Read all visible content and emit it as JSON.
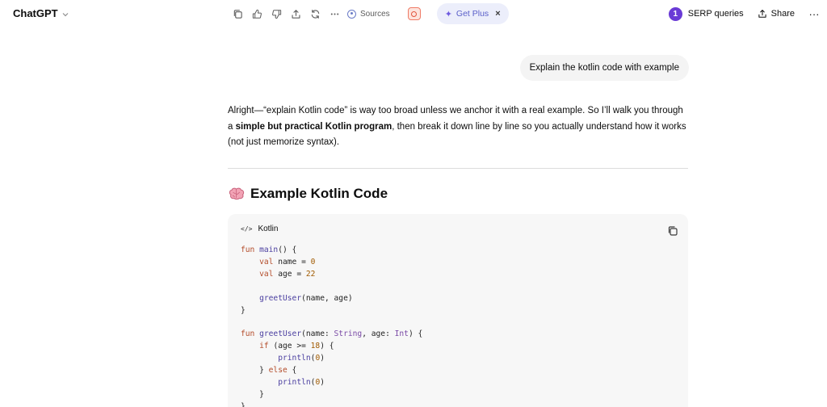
{
  "app": {
    "title": "ChatGPT"
  },
  "toolbar": {
    "sources_label": "Sources",
    "get_plus_label": "Get Plus",
    "get_plus_close": "×",
    "icons": [
      "copy-icon",
      "thumbs-up-icon",
      "thumbs-down-icon",
      "share-up-icon",
      "regenerate-icon",
      "more-icon",
      "sources-icon",
      "extension-icon"
    ]
  },
  "header_right": {
    "serp_badge": "1",
    "serp_label": "SERP queries",
    "share_label": "Share",
    "more_label": "···"
  },
  "conversation": {
    "user_message": "Explain the kotlin code with example",
    "reply": {
      "p1_a": "Alright—“explain Kotlin code” is way too broad unless we anchor it with a real example. So I’ll walk you through a ",
      "p1_bold": "simple but practical Kotlin program",
      "p1_b": ", then break it down line by line so you actually understand how it works (not just memorize syntax)."
    },
    "section_heading": "Example Kotlin Code",
    "code": {
      "language": "Kotlin",
      "lines": [
        "fun main() {",
        "    val name = \"Shishir\"",
        "    val age = 22",
        "",
        "    greetUser(name, age)",
        "}",
        "",
        "fun greetUser(name: String, age: Int) {",
        "    if (age >= 18) {",
        "        println(\"Hello $name, you are an adult.\")",
        "    } else {",
        "        println(\"Hello $name, you are a minor.\")",
        "    }",
        "}"
      ]
    }
  },
  "colors": {
    "accent": "#6a3bd6",
    "get_plus_bg": "#eceefb",
    "user_bubble_bg": "#f4f4f4",
    "code_bg": "#f7f7f7"
  }
}
